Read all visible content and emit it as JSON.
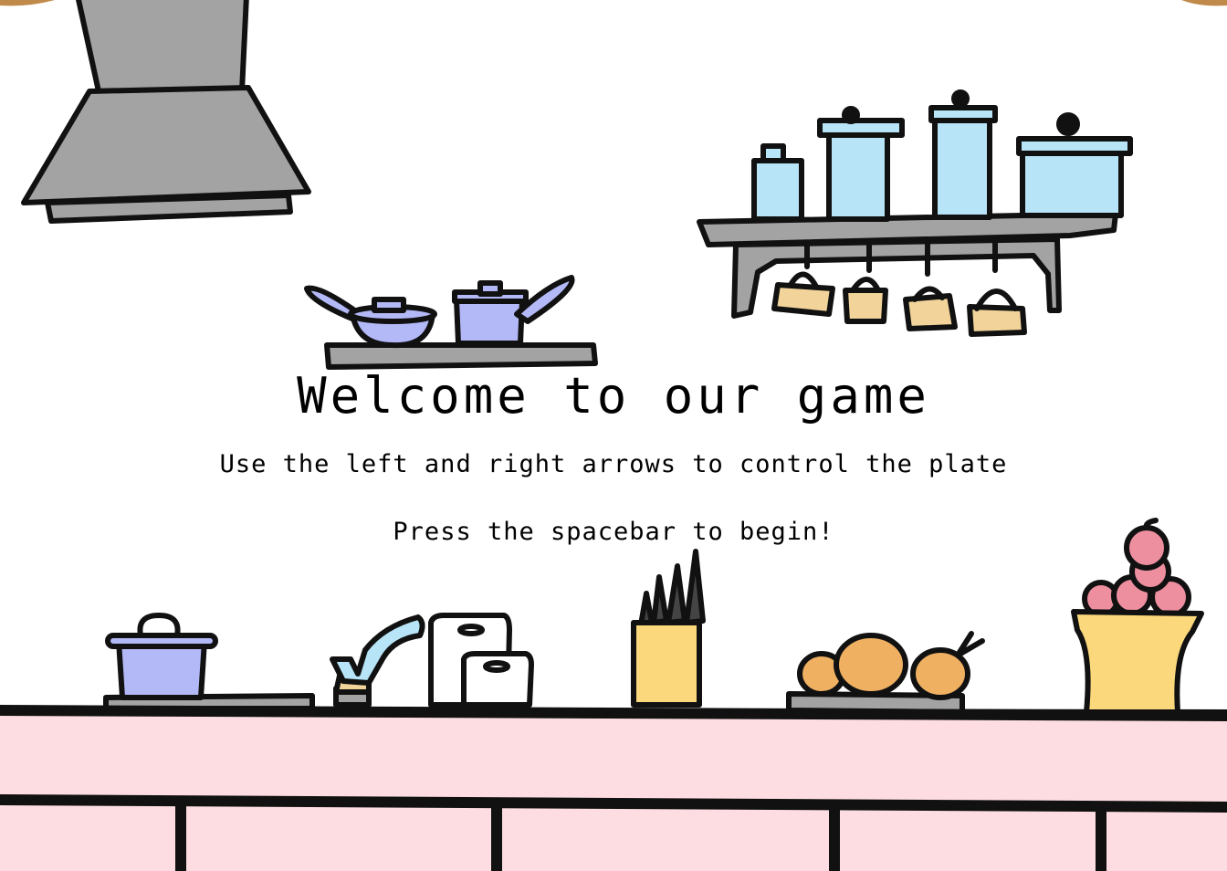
{
  "screen": {
    "title": "Welcome to our game",
    "instruction": "Use the left and right arrows to control the plate",
    "start_prompt": "Press the spacebar to begin!"
  },
  "colors": {
    "background": "#ffffff",
    "outline": "#111111",
    "steel": "#a3a3a3",
    "jar_blue": "#b7e4f6",
    "pan_lavender": "#b3b9f7",
    "mug_tan": "#f2d49a",
    "cabinet_pink": "#fddde1",
    "crock_yellow": "#fbd87b",
    "bread_orange": "#efb062",
    "apple_pink": "#ee8f9f"
  },
  "scene_objects": [
    "range-hood",
    "jar-shelf",
    "pan-shelf",
    "stove-burner",
    "faucet",
    "cutting-boards",
    "knife-block",
    "bread-board",
    "fruit-bowl",
    "kitchen-counter"
  ]
}
